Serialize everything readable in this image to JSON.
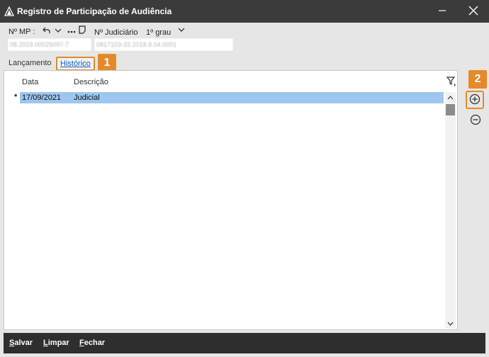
{
  "window": {
    "title": "Registro de Participação de Audiência",
    "minimize_icon": "minimize-icon",
    "close_icon": "close-icon"
  },
  "header": {
    "mp_label": "Nº MP :",
    "mp_value": "08.2019.00025097-7",
    "judiciario_label": "Nº Judiciário",
    "grau_label": "1º grau",
    "judiciario_value": "0817103-33.2018.8.04.0001"
  },
  "tabs": [
    {
      "label": "Lançamento",
      "active": false
    },
    {
      "label": "Histórico",
      "active": true
    }
  ],
  "callouts": [
    "1",
    "2"
  ],
  "grid": {
    "columns": [
      "Data",
      "Descrição"
    ],
    "rows": [
      {
        "marker": "*",
        "data": "17/09/2021",
        "descricao": "Judicial",
        "selected": true
      }
    ]
  },
  "side_actions": {
    "add_icon": "plus-circle-icon",
    "remove_icon": "minus-circle-icon"
  },
  "footer": {
    "buttons": [
      {
        "first": "S",
        "rest": "alvar"
      },
      {
        "first": "L",
        "rest": "impar"
      },
      {
        "first": "F",
        "rest": "echar"
      }
    ]
  },
  "colors": {
    "titlebar": "#3b3b3b",
    "footer": "#2e2e2e",
    "highlight": "#e58a2b",
    "selected_row": "#9dc7f0",
    "active_tab_text": "#1a5fb4"
  }
}
